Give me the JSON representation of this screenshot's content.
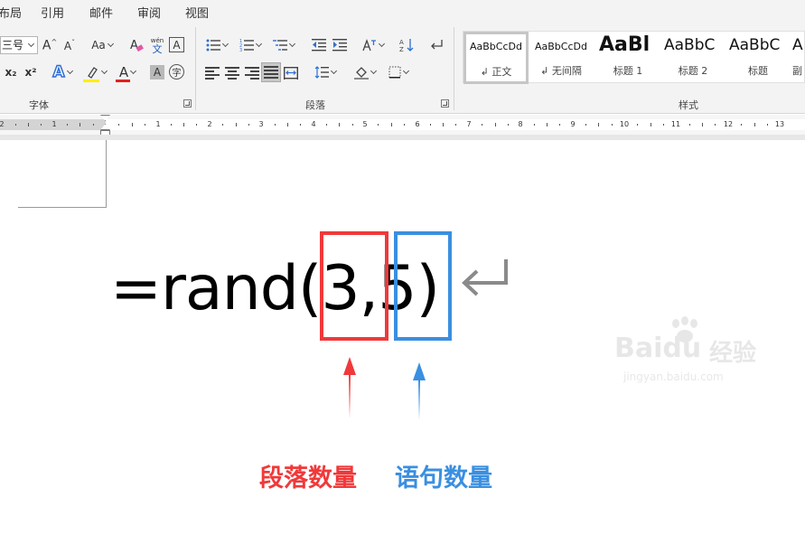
{
  "menu": {
    "tabs": [
      "布局",
      "引用",
      "邮件",
      "审阅",
      "视图"
    ]
  },
  "ribbon": {
    "font_size_value": "三号",
    "font_group_label": "字体",
    "paragraph_group_label": "段落",
    "styles_group_label": "样式",
    "change_case_label": "Aa",
    "pinyin_top": "wén",
    "pinyin_bottom": "文",
    "border_char": "A",
    "shading_char": "A",
    "enclose_char": "字",
    "subscript": "x₂",
    "superscript": "x²",
    "text_effect": "A",
    "font_color_char": "A",
    "highlight_color": "#ffee00",
    "font_color": "#e0201c",
    "styles": [
      {
        "sample": "AaBbCcDd",
        "name": "↲ 正文"
      },
      {
        "sample": "AaBbCcDd",
        "name": "↲ 无间隔"
      },
      {
        "sample": "AaBl",
        "name": "标题 1"
      },
      {
        "sample": "AaBbC",
        "name": "标题 2"
      },
      {
        "sample": "AaBbC",
        "name": "标题"
      },
      {
        "sample": "A",
        "name": "副"
      }
    ]
  },
  "ruler": {
    "numbers": [
      "2",
      "1",
      "1",
      "2",
      "3",
      "4",
      "5",
      "6",
      "7",
      "8",
      "9",
      "10",
      "11",
      "12",
      "13"
    ]
  },
  "document": {
    "formula": "=rand(3,5)",
    "caption_paragraphs": "段落数量",
    "caption_sentences": "语句数量",
    "highlight_red": "#f0393a",
    "highlight_blue": "#3a8fe0"
  },
  "watermark": {
    "brand": "Baidu",
    "brand_cn": "经验",
    "url": "jingyan.baidu.com"
  }
}
